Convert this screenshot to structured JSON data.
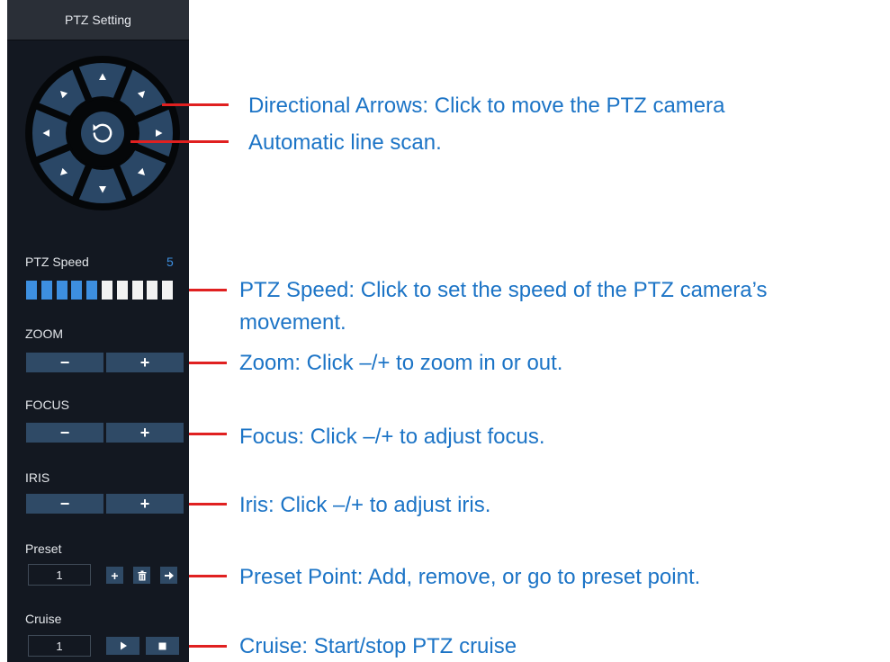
{
  "panel": {
    "title": "PTZ Setting",
    "speed": {
      "label": "PTZ Speed",
      "value": "5",
      "level": 5,
      "segments": 10
    },
    "zoom": {
      "label": "ZOOM",
      "minus": "−",
      "plus": "+"
    },
    "focus": {
      "label": "FOCUS",
      "minus": "−",
      "plus": "+"
    },
    "iris": {
      "label": "IRIS",
      "minus": "−",
      "plus": "+"
    },
    "preset": {
      "label": "Preset",
      "value": "1",
      "add": "+"
    },
    "cruise": {
      "label": "Cruise",
      "value": "1"
    }
  },
  "annotations": {
    "directional": "Directional Arrows: Click to move the PTZ camera",
    "autoscan": "Automatic line scan.",
    "speed_line1": "PTZ Speed: Click to set the speed of the PTZ camera’s",
    "speed_line2": "movement.",
    "zoom": "Zoom: Click –/+ to zoom in or out.",
    "focus": "Focus: Click –/+ to adjust focus.",
    "iris": "Iris: Click –/+ to adjust iris.",
    "preset": "Preset Point: Add, remove, or go to preset point.",
    "cruise": "Cruise: Start/stop PTZ cruise"
  },
  "colors": {
    "panel_bg": "#131821",
    "button_bg": "#2f4a66",
    "speed_active": "#3d8fe0",
    "speed_inactive": "#f2f2f2",
    "callout_line": "#e02020",
    "callout_text": "#1c74c6"
  }
}
